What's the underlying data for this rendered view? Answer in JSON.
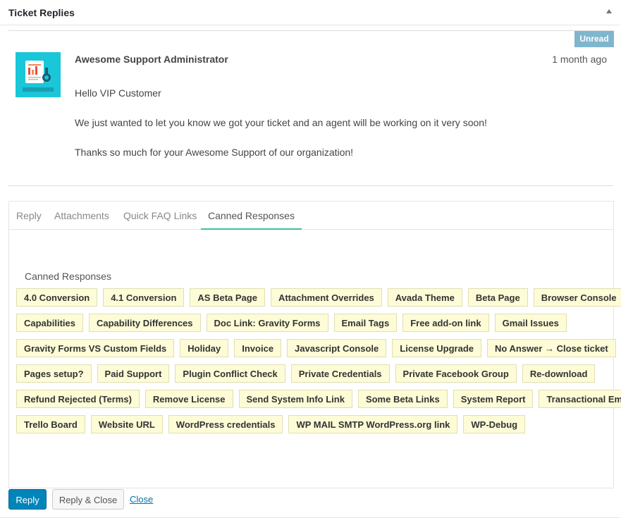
{
  "panel": {
    "title": "Ticket Replies"
  },
  "reply": {
    "badge": "Unread",
    "author": "Awesome Support Administrator",
    "time": "1 month ago",
    "paragraphs": [
      "Hello VIP Customer",
      "We just wanted to let you know we got your ticket and an agent will be working on it very soon!",
      "Thanks so much for your Awesome Support of our organization!"
    ],
    "avatar_caption": "Market Research"
  },
  "tabs": [
    {
      "label": "Reply"
    },
    {
      "label": "Attachments"
    },
    {
      "label": "Quick FAQ Links"
    },
    {
      "label": "Canned Responses",
      "active": true
    }
  ],
  "canned": {
    "heading": "Canned Responses",
    "rows": [
      [
        "4.0 Conversion",
        "4.1 Conversion",
        "AS Beta Page",
        "Attachment Overrides",
        "Avada Theme",
        "Beta Page",
        "Browser Console"
      ],
      [
        "Capabilities",
        "Capability Differences",
        "Doc Link: Gravity Forms",
        "Email Tags",
        "Free add-on link",
        "Gmail Issues"
      ],
      [
        "Gravity Forms VS Custom Fields",
        "Holiday",
        "Invoice",
        "Javascript Console",
        "License Upgrade",
        "No Answer → Close ticket"
      ],
      [
        "Pages setup?",
        "Paid Support",
        "Plugin Conflict Check",
        "Private Credentials",
        "Private Facebook Group",
        "Re-download"
      ],
      [
        "Refund Rejected (Terms)",
        "Remove License",
        "Send System Info Link",
        "Some Beta Links",
        "System Report",
        "Transactional Email"
      ],
      [
        "Trello Board",
        "Website URL",
        "WordPress credentials",
        "WP MAIL SMTP WordPress.org link",
        "WP-Debug"
      ]
    ]
  },
  "actions": {
    "reply": "Reply",
    "reply_close": "Reply & Close",
    "close": "Close"
  },
  "colors": {
    "accent": "#0085ba",
    "tab_active": "#3cbf9e",
    "badge": "#7fb6cd",
    "canned_bg": "#fdfcd7",
    "avatar_bg": "#19c7d9"
  }
}
